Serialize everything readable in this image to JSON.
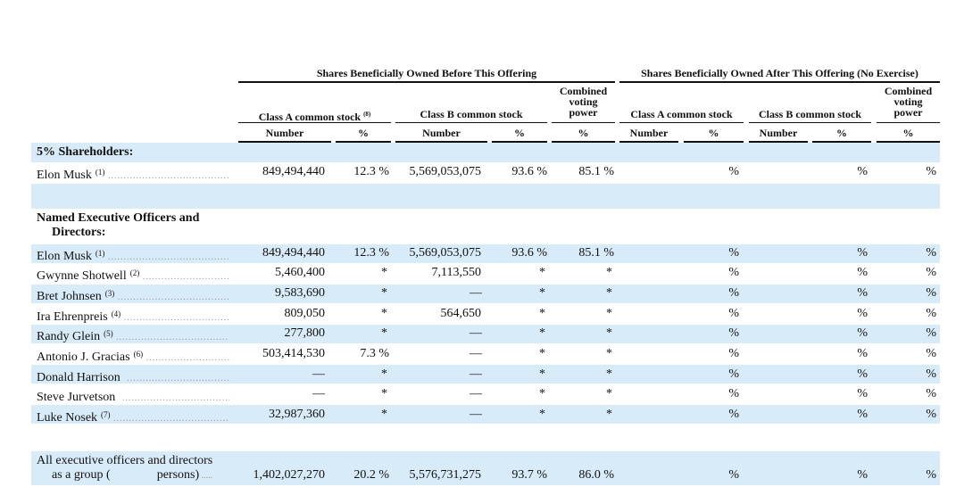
{
  "headers": {
    "before": "Shares Beneficially Owned Before This Offering",
    "after": "Shares Beneficially Owned After This Offering (No Exercise)",
    "class_a": "Class A common stock",
    "class_a_note": "(8)",
    "class_b": "Class B common stock",
    "combined": [
      "Combined",
      "voting",
      "power"
    ],
    "number": "Number",
    "percent": "%"
  },
  "sections": {
    "five_percent": "5% Shareholders:",
    "officers_line1": "Named Executive Officers and",
    "officers_line2": "Directors:"
  },
  "rows_5pct": [
    {
      "name": "Elon Musk",
      "note": "(1)",
      "a_num": "849,494,440",
      "a_pct": "12.3 %",
      "b_num": "5,569,053,075",
      "b_pct": "93.6 %",
      "vote": "85.1 %",
      "after_a_pct": "%",
      "after_b_pct": "%",
      "after_vote": "%"
    }
  ],
  "rows_officers": [
    {
      "name": "Elon Musk",
      "note": "(1)",
      "a_num": "849,494,440",
      "a_pct": "12.3 %",
      "b_num": "5,569,053,075",
      "b_pct": "93.6 %",
      "vote": "85.1 %",
      "after_a_pct": "%",
      "after_b_pct": "%",
      "after_vote": "%"
    },
    {
      "name": "Gwynne Shotwell",
      "note": "(2)",
      "a_num": "5,460,400",
      "a_pct": "*",
      "b_num": "7,113,550",
      "b_pct": "*",
      "vote": "*",
      "after_a_pct": "%",
      "after_b_pct": "%",
      "after_vote": "%"
    },
    {
      "name": "Bret Johnsen",
      "note": "(3)",
      "a_num": "9,583,690",
      "a_pct": "*",
      "b_num": "—",
      "b_pct": "*",
      "vote": "*",
      "after_a_pct": "%",
      "after_b_pct": "%",
      "after_vote": "%"
    },
    {
      "name": "Ira Ehrenpreis",
      "note": "(4)",
      "a_num": "809,050",
      "a_pct": "*",
      "b_num": "564,650",
      "b_pct": "*",
      "vote": "*",
      "after_a_pct": "%",
      "after_b_pct": "%",
      "after_vote": "%"
    },
    {
      "name": "Randy Glein",
      "note": "(5)",
      "a_num": "277,800",
      "a_pct": "*",
      "b_num": "—",
      "b_pct": "*",
      "vote": "*",
      "after_a_pct": "%",
      "after_b_pct": "%",
      "after_vote": "%"
    },
    {
      "name": "Antonio J. Gracias",
      "note": "(6)",
      "a_num": "503,414,530",
      "a_pct": "7.3 %",
      "b_num": "—",
      "b_pct": "*",
      "vote": "*",
      "after_a_pct": "%",
      "after_b_pct": "%",
      "after_vote": "%"
    },
    {
      "name": "Donald Harrison",
      "note": "",
      "a_num": "—",
      "a_pct": "*",
      "b_num": "—",
      "b_pct": "*",
      "vote": "*",
      "after_a_pct": "%",
      "after_b_pct": "%",
      "after_vote": "%"
    },
    {
      "name": "Steve Jurvetson",
      "note": "",
      "a_num": "—",
      "a_pct": "*",
      "b_num": "—",
      "b_pct": "*",
      "vote": "*",
      "after_a_pct": "%",
      "after_b_pct": "%",
      "after_vote": "%"
    },
    {
      "name": "Luke Nosek",
      "note": "(7)",
      "a_num": "32,987,360",
      "a_pct": "*",
      "b_num": "—",
      "b_pct": "*",
      "vote": "*",
      "after_a_pct": "%",
      "after_b_pct": "%",
      "after_vote": "%"
    }
  ],
  "total": {
    "line1": "All executive officers and directors",
    "line2_a": "as a group (",
    "line2_b": "persons)",
    "a_num": "1,402,027,270",
    "a_pct": "20.2 %",
    "b_num": "5,576,731,275",
    "b_pct": "93.7 %",
    "vote": "86.0 %",
    "after_a_pct": "%",
    "after_b_pct": "%",
    "after_vote": "%"
  }
}
